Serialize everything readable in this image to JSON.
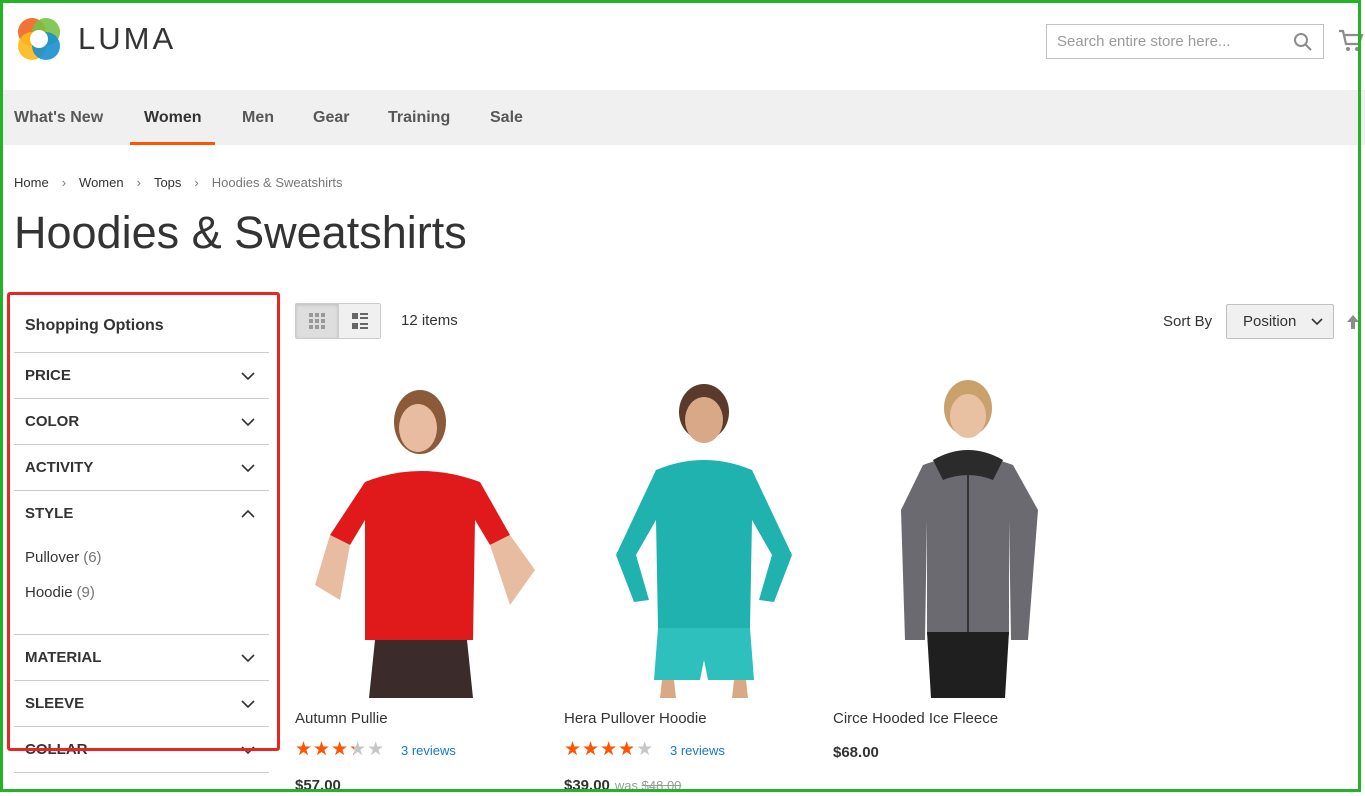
{
  "header": {
    "logo_text": "LUMA",
    "search_placeholder": "Search entire store here..."
  },
  "nav": {
    "items": [
      {
        "label": "What's New"
      },
      {
        "label": "Women",
        "active": true
      },
      {
        "label": "Men"
      },
      {
        "label": "Gear"
      },
      {
        "label": "Training"
      },
      {
        "label": "Sale"
      }
    ]
  },
  "breadcrumb": [
    "Home",
    "Women",
    "Tops",
    "Hoodies & Sweatshirts"
  ],
  "page_title": "Hoodies & Sweatshirts",
  "sidebar": {
    "title": "Shopping Options",
    "filters": [
      {
        "label": "PRICE",
        "expanded": false
      },
      {
        "label": "COLOR",
        "expanded": false
      },
      {
        "label": "ACTIVITY",
        "expanded": false
      },
      {
        "label": "STYLE",
        "expanded": true,
        "options": [
          {
            "label": "Pullover",
            "count": "(6)"
          },
          {
            "label": "Hoodie",
            "count": "(9)"
          }
        ]
      },
      {
        "label": "MATERIAL",
        "expanded": false
      },
      {
        "label": "SLEEVE",
        "expanded": false
      },
      {
        "label": "COLLAR",
        "expanded": false
      }
    ]
  },
  "toolbar": {
    "item_count": "12 items",
    "sort_label": "Sort By",
    "sort_value": "Position"
  },
  "products": [
    {
      "name": "Autumn Pullie",
      "rating": 0.6,
      "reviews": "3 reviews",
      "price": "$57.00",
      "was_label": "",
      "old_price": ""
    },
    {
      "name": "Hera Pullover Hoodie",
      "rating": 0.7,
      "reviews": "3 reviews",
      "price": "$39.00",
      "was_label": "was",
      "old_price": "$48.00"
    },
    {
      "name": "Circe Hooded Ice Fleece",
      "price": "$68.00"
    }
  ],
  "colors": {
    "accent": "#ff5501",
    "link": "#1979c3",
    "annotation_red": "#e8261f",
    "annotation_green": "#22b326"
  }
}
